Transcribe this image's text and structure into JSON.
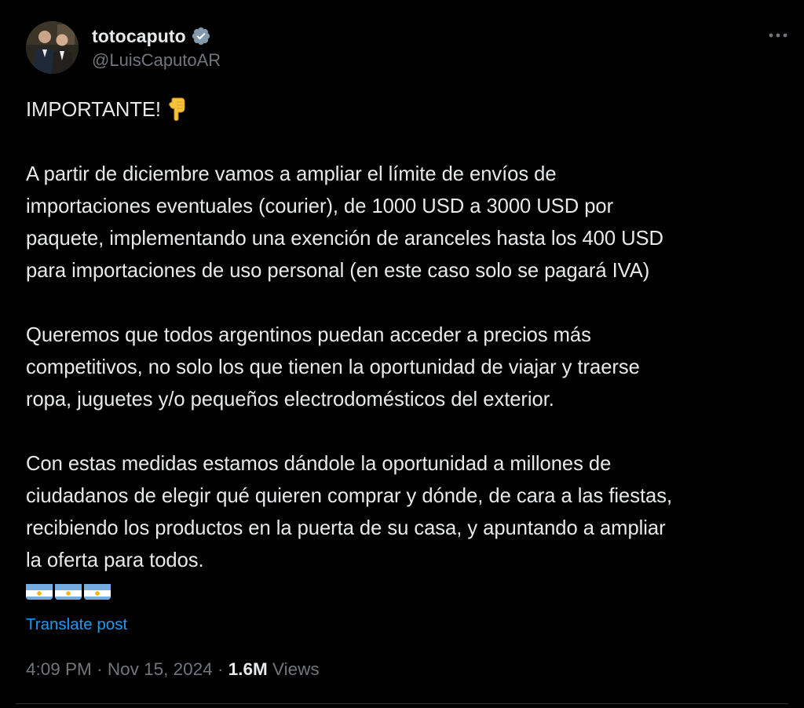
{
  "author": {
    "display_name": "totocaputo",
    "handle": "@LuisCaputoAR",
    "verified": true
  },
  "post": {
    "paragraphs": [
      [
        "IMPORTANTE!"
      ],
      [
        "A partir de diciembre vamos a ampliar el límite de envíos de",
        "importaciones eventuales (courier), de 1000 USD a 3000 USD por",
        "paquete, implementando una exención de aranceles hasta los 400 USD",
        "para importaciones de uso personal (en este caso solo se pagará IVA)"
      ],
      [
        "Queremos que todos argentinos puedan acceder a precios más",
        "competitivos, no solo los que tienen la oportunidad de viajar y traerse",
        "ropa, juguetes y/o pequeños electrodomésticos del exterior."
      ],
      [
        "Con estas medidas estamos dándole la oportunidad a millones de",
        "ciudadanos de elegir qué quieren comprar y dónde, de cara a las fiestas,",
        "recibiendo los productos en la puerta de su casa, y apuntando a ampliar",
        "la oferta para todos."
      ]
    ],
    "flag_emoji_count": 3,
    "translate_label": "Translate post"
  },
  "meta": {
    "time": "4:09 PM",
    "separator": "·",
    "date": "Nov 15, 2024",
    "views_count": "1.6M",
    "views_label": "Views"
  },
  "icons": {
    "verified": "verified-badge-icon",
    "more": "more-options-icon",
    "point_down": "backhand-index-pointing-down-emoji",
    "flag": "flag-argentina-emoji"
  },
  "colors": {
    "background": "#000000",
    "text": "#e7e9ea",
    "secondary": "#71767b",
    "link": "#1d9bf0",
    "verified": "#829aab"
  }
}
